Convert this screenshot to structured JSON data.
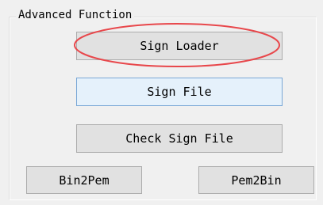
{
  "group": {
    "title": "Advanced Function"
  },
  "buttons": {
    "sign_loader": "Sign Loader",
    "sign_file": "Sign File",
    "check_sign_file": "Check Sign File",
    "bin2pem": "Bin2Pem",
    "pem2bin": "Pem2Bin"
  },
  "colors": {
    "annotation_ellipse": "#e8474b",
    "focus_border": "#7aa7d6",
    "button_face": "#e1e1e1"
  }
}
